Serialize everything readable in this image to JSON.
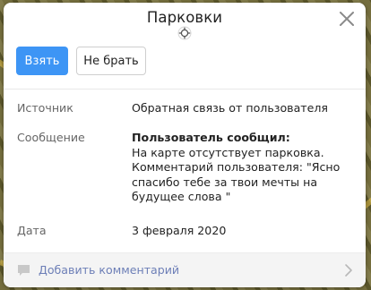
{
  "dialog": {
    "title": "Парковки"
  },
  "actions": {
    "take_label": "Взять",
    "skip_label": "Не брать"
  },
  "details": {
    "source_label": "Источник",
    "source_value": "Обратная связь от пользователя",
    "message_label": "Сообщение",
    "message_heading": "Пользователь сообщил:",
    "message_line1": "На карте отсутствует парковка.",
    "message_line2": "Комментарий пользователя: \"Ясно спасибо тебе за твои мечты на будущее слова \"",
    "date_label": "Дата",
    "date_value": "3 февраля 2020"
  },
  "footer": {
    "add_comment_label": "Добавить комментарий"
  },
  "icons": {
    "close": "close-icon",
    "target": "target-icon",
    "comment": "comment-icon",
    "chevron": "chevron-right-icon"
  },
  "colors": {
    "primary_button": "#3d95f5",
    "footer_link": "#6d7fb7",
    "footer_bg": "#f4f4f4"
  }
}
